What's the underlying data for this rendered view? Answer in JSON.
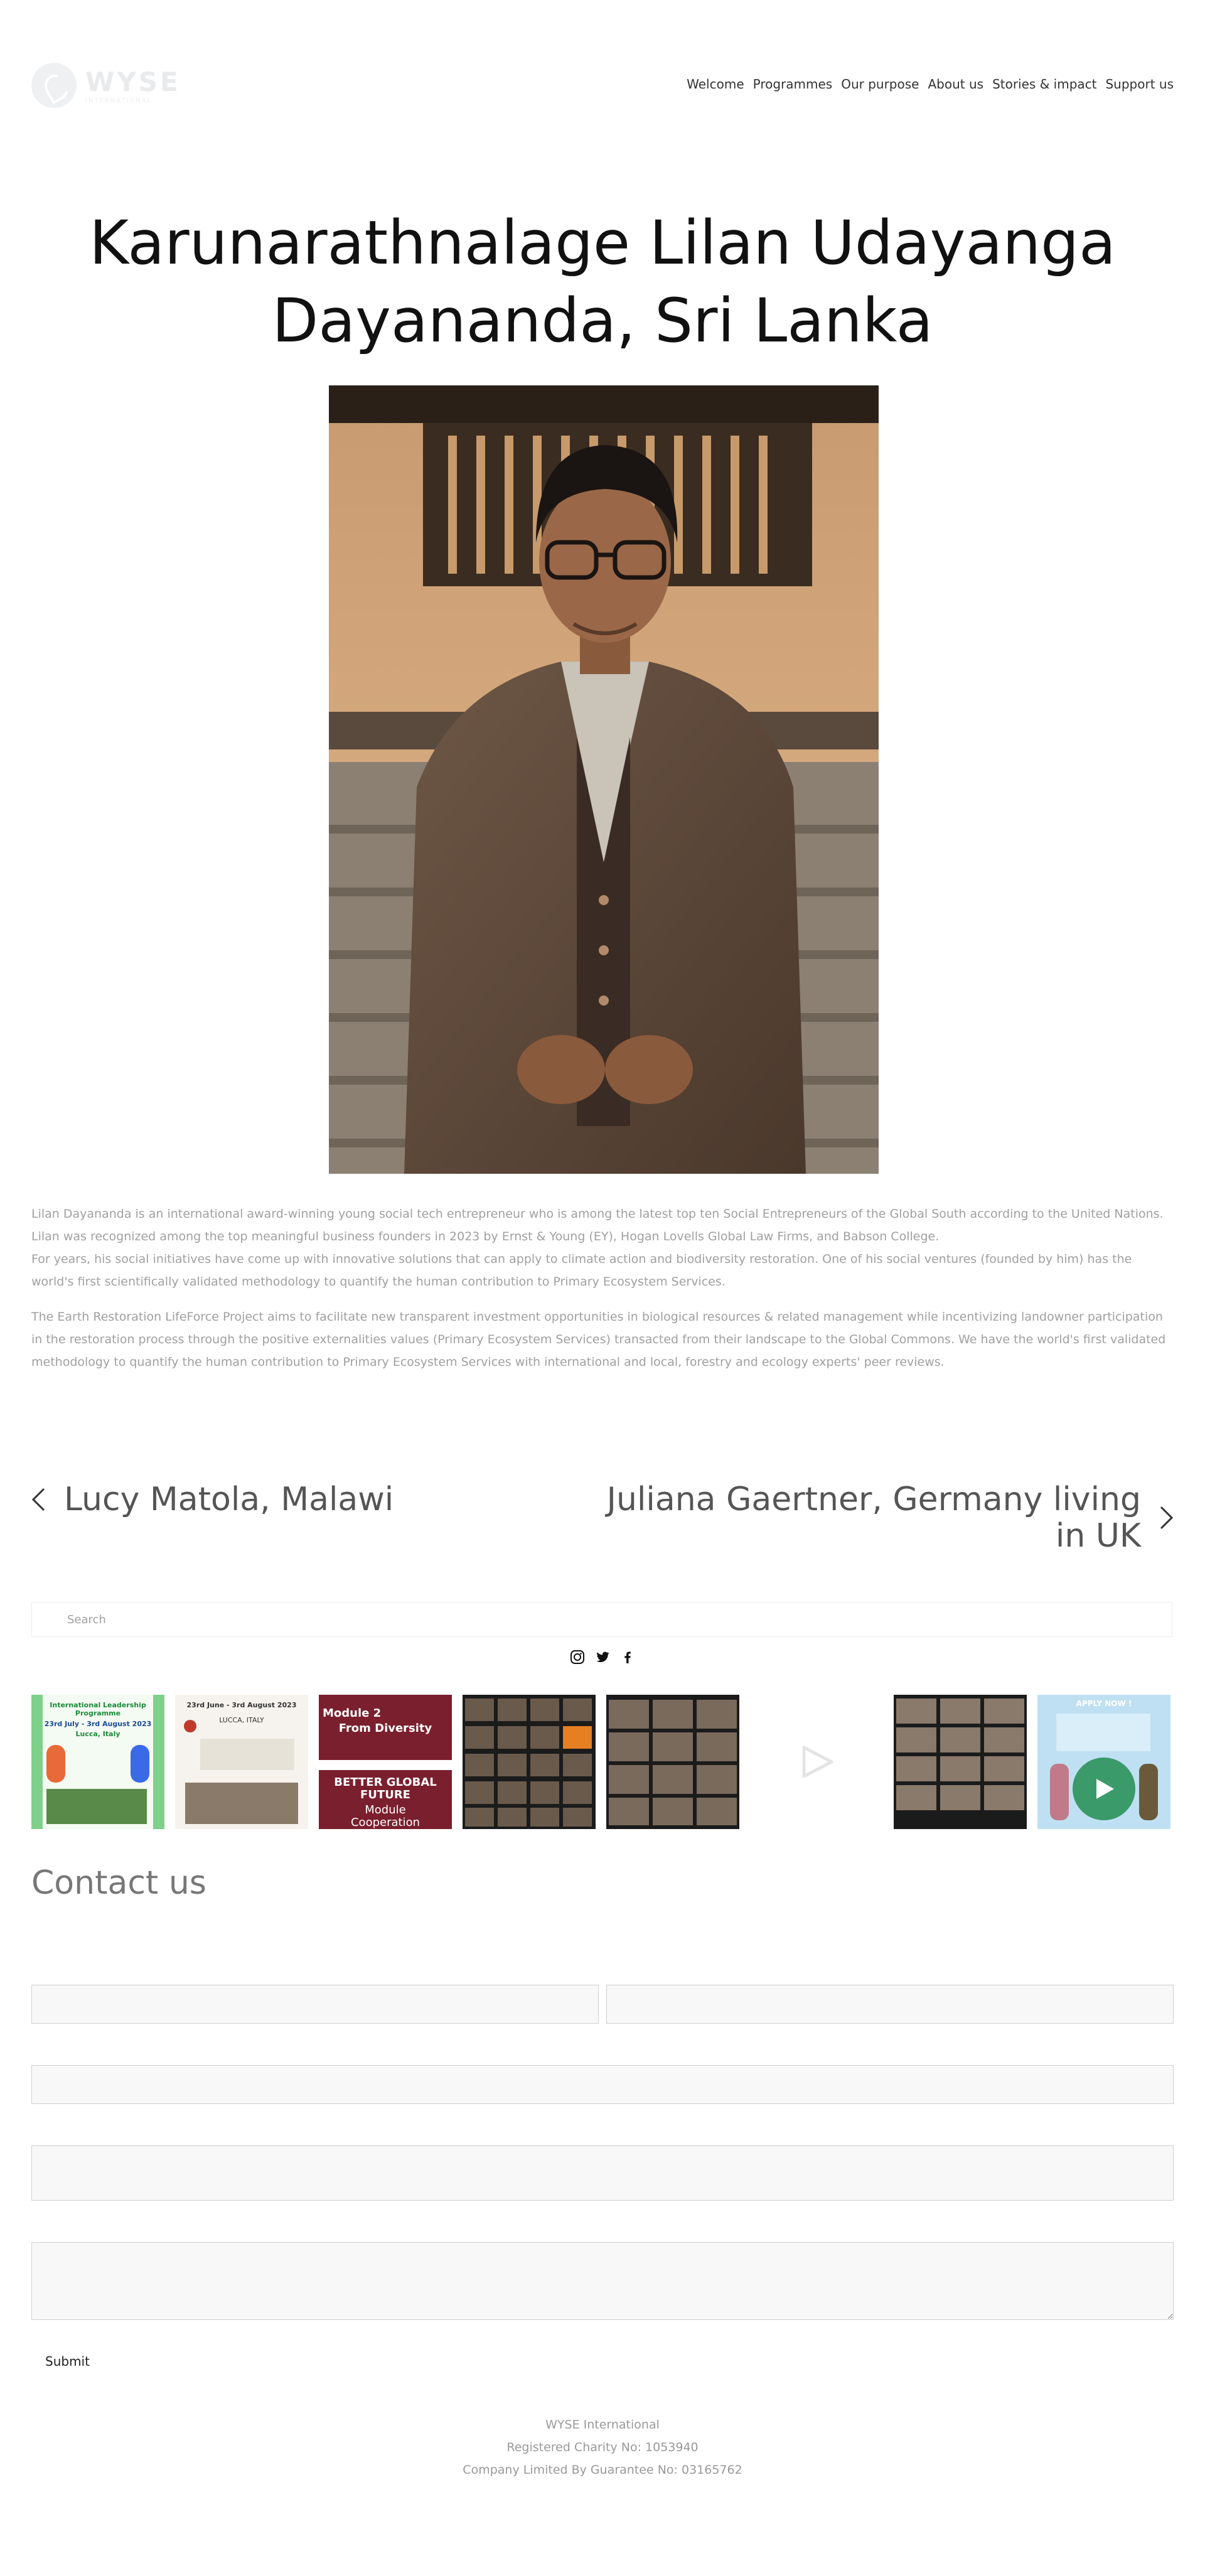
{
  "header": {
    "logo_text": "WYSE",
    "logo_subtext": "INTERNATIONAL",
    "nav": [
      "Welcome",
      "Programmes",
      "Our purpose",
      "About us",
      "Stories & impact",
      "Support us"
    ]
  },
  "page": {
    "title": "Karunarathnalage Lilan Udayanga Dayananda, Sri Lanka",
    "bio": [
      "Lilan Dayananda is an international award-winning young social tech entrepreneur who is among the latest top ten Social Entrepreneurs of the Global South according to the United Nations. Lilan was recognized among the top meaningful business founders in 2023 by Ernst & Young (EY), Hogan Lovells Global Law Firms, and Babson College.",
      "For years, his social initiatives have come up with innovative solutions that can apply to climate action and biodiversity restoration. One of his social ventures (founded by him) has the world's first scientifically validated methodology to quantify the human contribution to Primary Ecosystem Services.",
      "The Earth Restoration LifeForce Project aims to facilitate new transparent investment opportunities in biological resources & related management while incentivizing landowner participation in the restoration process through the positive externalities values (Primary Ecosystem Services) transacted from their landscape to the Global Commons. We have the world's first validated methodology to quantify the human contribution to Primary Ecosystem Services with international and local, forestry and ecology experts' peer reviews."
    ]
  },
  "post_nav": {
    "prev": "Lucy Matola, Malawi",
    "next": "Juliana Gaertner, Germany living in UK"
  },
  "search": {
    "placeholder": "Search"
  },
  "social_icons": [
    "instagram-icon",
    "twitter-icon",
    "facebook-icon"
  ],
  "instagram": {
    "tiles": [
      {
        "name": "leadership-programme-poster",
        "lines": [
          "International Leadership Programme",
          "23rd July - 3rd August 2023",
          "Lucca, Italy"
        ]
      },
      {
        "name": "dates-poster",
        "lines": [
          "23rd June - 3rd August 2023",
          "LUCCA, ITALY"
        ]
      },
      {
        "name": "module-poster",
        "lines": [
          "Module 2",
          "From Diversity",
          "BETTER GLOBAL FUTURE",
          "Module",
          "Cooperation"
        ]
      },
      {
        "name": "video-call-1",
        "lines": []
      },
      {
        "name": "video-call-2",
        "lines": []
      },
      {
        "name": "video-placeholder",
        "lines": []
      },
      {
        "name": "video-call-3",
        "lines": []
      },
      {
        "name": "apply-now-poster",
        "lines": [
          "APPLY NOW !"
        ]
      }
    ]
  },
  "contact": {
    "title": "Contact us",
    "submit_label": "Submit"
  },
  "footer": {
    "lines": [
      "WYSE International",
      "Registered Charity No: 1053940",
      "Company Limited By Guarantee No: 03165762"
    ]
  },
  "colors": {
    "text_dark": "#111111",
    "text_muted": "#a0a0a0",
    "field_bg": "#f8f8f8",
    "field_border": "#cfcfcf"
  }
}
